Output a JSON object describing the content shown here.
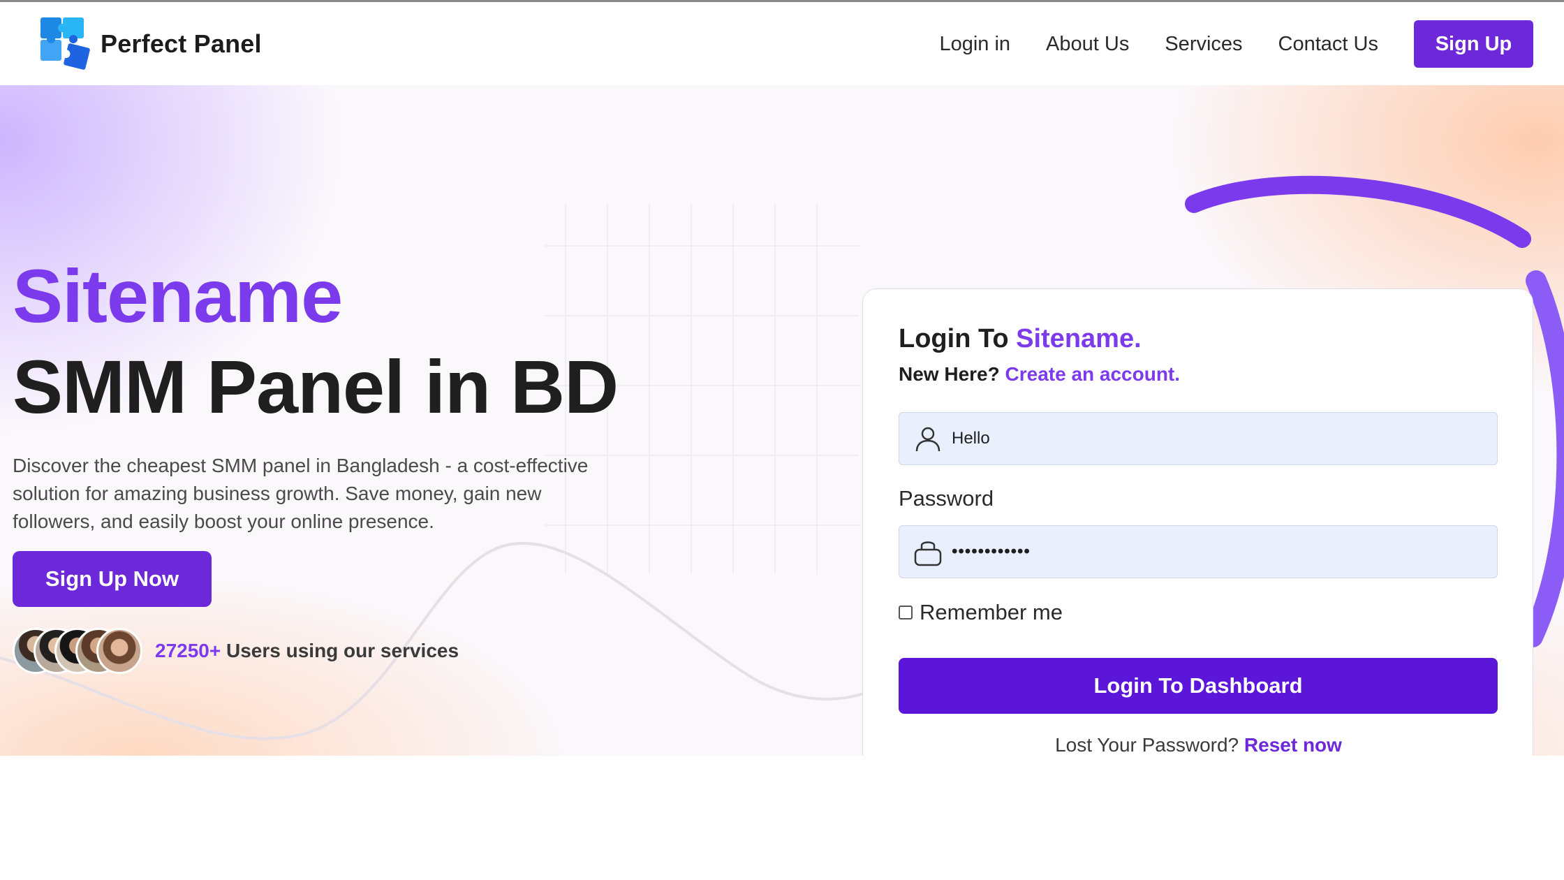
{
  "brand": {
    "name": "Perfect Panel",
    "logo_icon": "puzzle-logo-icon"
  },
  "nav": {
    "links": [
      "Login in",
      "About Us",
      "Services",
      "Contact Us"
    ],
    "signup_label": "Sign Up"
  },
  "hero": {
    "title": "Sitename",
    "subtitle": "SMM Panel in BD",
    "description": "Discover the cheapest SMM panel in Bangladesh - a cost-effective solution for amazing business growth. Save money, gain new followers, and easily boost your online presence.",
    "cta_label": "Sign Up Now",
    "users_count": "27250+",
    "users_text": " Users using our services"
  },
  "login": {
    "title_prefix": "Login To ",
    "title_accent": "Sitename.",
    "new_here": "New Here? ",
    "create_account": "Create an account.",
    "username_value": "Hello",
    "password_label": "Password",
    "password_value": "••••••••••••",
    "remember_label": "Remember me",
    "remember_checked": false,
    "submit_label": "Login To Dashboard",
    "lost_password": "Lost Your Password? ",
    "reset_link": "Reset now"
  },
  "colors": {
    "accent": "#7c3aed",
    "button": "#6d28d9",
    "input_bg": "#e9effc"
  }
}
